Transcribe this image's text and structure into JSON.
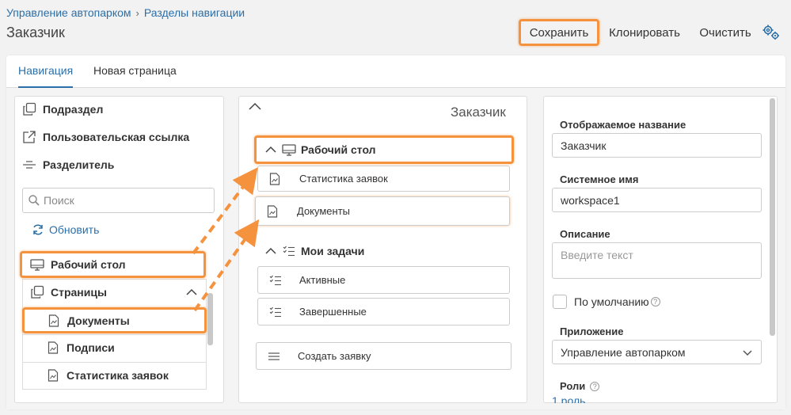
{
  "breadcrumb": {
    "root": "Управление автопарком",
    "separator": "›",
    "current": "Разделы навигации"
  },
  "page_title": "Заказчик",
  "toolbar": {
    "save_label": "Сохранить",
    "clone_label": "Клонировать",
    "clear_label": "Очистить",
    "settings_icon": "gear-icon"
  },
  "tabs": [
    {
      "label": "Навигация",
      "active": true
    },
    {
      "label": "Новая страница",
      "active": false
    }
  ],
  "left_panel": {
    "palette": [
      {
        "label": "Подраздел",
        "icon": "copy-icon"
      },
      {
        "label": "Пользовательская ссылка",
        "icon": "external-link-icon"
      },
      {
        "label": "Разделитель",
        "icon": "divider-icon"
      }
    ],
    "search_placeholder": "Поиск",
    "refresh_label": "Обновить",
    "workspace_label": "Рабочий стол",
    "pages_label": "Страницы",
    "pages": [
      {
        "label": "Документы",
        "highlighted": true
      },
      {
        "label": "Подписи",
        "highlighted": false
      },
      {
        "label": "Статистика заявок",
        "highlighted": false
      }
    ]
  },
  "middle_panel": {
    "title": "Заказчик",
    "groups": [
      {
        "label": "Рабочий стол",
        "icon": "monitor-icon",
        "items": [
          {
            "label": "Статистика заявок",
            "icon": "page-icon"
          },
          {
            "label": "Документы",
            "icon": "page-icon"
          }
        ]
      },
      {
        "label": "Мои задачи",
        "icon": "task-list-icon",
        "items": [
          {
            "label": "Активные",
            "icon": "task-list-icon"
          },
          {
            "label": "Завершенные",
            "icon": "task-list-icon"
          }
        ]
      }
    ],
    "create_item": {
      "label": "Создать заявку",
      "icon": "lines-icon"
    }
  },
  "right_panel": {
    "display_name_label": "Отображаемое название",
    "display_name_value": "Заказчик",
    "system_name_label": "Системное имя",
    "system_name_value": "workspace1",
    "description_label": "Описание",
    "description_placeholder": "Введите текст",
    "default_label": "По умолчанию",
    "app_label": "Приложение",
    "app_value": "Управление автопарком",
    "roles_label": "Роли",
    "roles_value": "1 роль"
  },
  "colors": {
    "accent": "#2b6fa8",
    "highlight": "#f5923e"
  }
}
